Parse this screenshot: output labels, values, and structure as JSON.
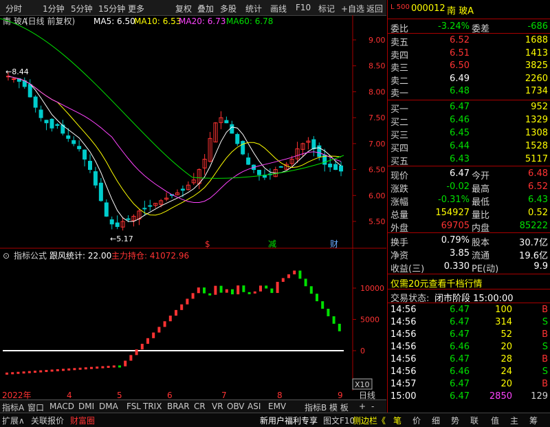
{
  "toolbar": {
    "items": [
      "分时",
      "1分钟",
      "5分钟",
      "15分钟",
      "更多",
      "复权",
      "叠加",
      "多股",
      "统计",
      "画线",
      "F10",
      "标记",
      "+自选",
      "返回"
    ]
  },
  "main_chart": {
    "stock_title": "南 玻A",
    "mode": "(日线 前复权)",
    "ma": [
      {
        "label": "MA5: 6.50",
        "color": "#ffffff"
      },
      {
        "label": "MA10: 6.53",
        "color": "#ffff00"
      },
      {
        "label": "MA20: 6.73",
        "color": "#ff44ff"
      },
      {
        "label": "MA60: 6.78",
        "color": "#00e000"
      }
    ],
    "y_ticks": [
      "9.00",
      "8.50",
      "8.00",
      "7.50",
      "7.00",
      "6.50",
      "6.00",
      "5.50"
    ],
    "high_label": "8.44",
    "low_label": "5.17",
    "markers": [
      {
        "text": "$",
        "color": "#ff3333"
      },
      {
        "text": "减",
        "color": "#00e000"
      },
      {
        "text": "财",
        "color": "#66aaff"
      }
    ]
  },
  "indicator": {
    "title": "指标公式",
    "name": "跟风统计: 22.00",
    "sub": "主力持仓: 41072.96",
    "y_ticks": [
      "10000",
      "5000",
      "0"
    ],
    "multiplier": "X10"
  },
  "x_axis": {
    "labels": [
      "2022年",
      "4",
      "5",
      "6",
      "7",
      "8",
      "9"
    ],
    "period": "日线"
  },
  "tabs": [
    "指标A",
    "窗口",
    "MACD",
    "DMI",
    "DMA",
    "FSL",
    "TRIX",
    "BRAR",
    "CR",
    "VR",
    "OBV",
    "ASI",
    "EMV",
    "指标B",
    "模 板",
    "+",
    "-"
  ],
  "footer": {
    "left": [
      "扩展∧",
      "关联报价",
      "财富圈"
    ],
    "right_text": "新用户福利专享",
    "f10": "图文F10",
    "side": "侧边栏《",
    "right_tabs": [
      "笔",
      "价",
      "细",
      "势",
      "联",
      "值",
      "主",
      "筹"
    ]
  },
  "panel": {
    "header_icon": "L 500",
    "code": "000012",
    "name": "南 玻A",
    "weibi_label": "委比",
    "weibi": "-3.24%",
    "weicha_label": "委差",
    "weicha": "-686",
    "sells": [
      {
        "label": "卖五",
        "price": "6.52",
        "vol": "1688"
      },
      {
        "label": "卖四",
        "price": "6.51",
        "vol": "1413"
      },
      {
        "label": "卖三",
        "price": "6.50",
        "vol": "3825"
      },
      {
        "label": "卖二",
        "price": "6.49",
        "vol": "2260"
      },
      {
        "label": "卖一",
        "price": "6.48",
        "vol": "1734"
      }
    ],
    "buys": [
      {
        "label": "买一",
        "price": "6.47",
        "vol": "952"
      },
      {
        "label": "买二",
        "price": "6.46",
        "vol": "1329"
      },
      {
        "label": "买三",
        "price": "6.45",
        "vol": "1308"
      },
      {
        "label": "买四",
        "price": "6.44",
        "vol": "1528"
      },
      {
        "label": "买五",
        "price": "6.43",
        "vol": "5117"
      }
    ],
    "quote": [
      {
        "l1": "现价",
        "v1": "6.47",
        "l2": "今开",
        "v2": "6.48"
      },
      {
        "l1": "涨跌",
        "v1": "-0.02",
        "l2": "最高",
        "v2": "6.52"
      },
      {
        "l1": "涨幅",
        "v1": "-0.31%",
        "l2": "最低",
        "v2": "6.43"
      },
      {
        "l1": "总量",
        "v1": "154927",
        "l2": "量比",
        "v2": "0.52"
      },
      {
        "l1": "外盘",
        "v1": "69705",
        "l2": "内盘",
        "v2": "85222"
      }
    ],
    "fin": [
      {
        "l1": "换手",
        "v1": "0.79%",
        "l2": "股本",
        "v2": "30.7亿"
      },
      {
        "l1": "净资",
        "v1": "3.85",
        "l2": "流通",
        "v2": "19.6亿"
      },
      {
        "l1": "收益(三)",
        "v1": "0.330",
        "l2": "PE(动)",
        "v2": "9.9"
      }
    ],
    "promo": "仅需20元查看千档行情",
    "status_label": "交易状态:",
    "status": "闭市阶段 15:00:00",
    "ticks": [
      {
        "t": "14:56",
        "p": "6.47",
        "v": "100",
        "s": "B"
      },
      {
        "t": "14:56",
        "p": "6.47",
        "v": "314",
        "s": "S"
      },
      {
        "t": "14:56",
        "p": "6.47",
        "v": "52",
        "s": "B"
      },
      {
        "t": "14:56",
        "p": "6.46",
        "v": "20",
        "s": "S"
      },
      {
        "t": "14:56",
        "p": "6.47",
        "v": "28",
        "s": "B"
      },
      {
        "t": "14:56",
        "p": "6.46",
        "v": "24",
        "s": "S"
      },
      {
        "t": "14:57",
        "p": "6.47",
        "v": "20",
        "s": "B"
      },
      {
        "t": "15:00",
        "p": "6.47",
        "v": "2850",
        "s": "129"
      }
    ]
  },
  "colors": {
    "up": "#ff3333",
    "down": "#00e000",
    "ma5": "#ffffff",
    "ma10": "#ffff00",
    "ma20": "#ff44ff",
    "ma60": "#00e000"
  }
}
